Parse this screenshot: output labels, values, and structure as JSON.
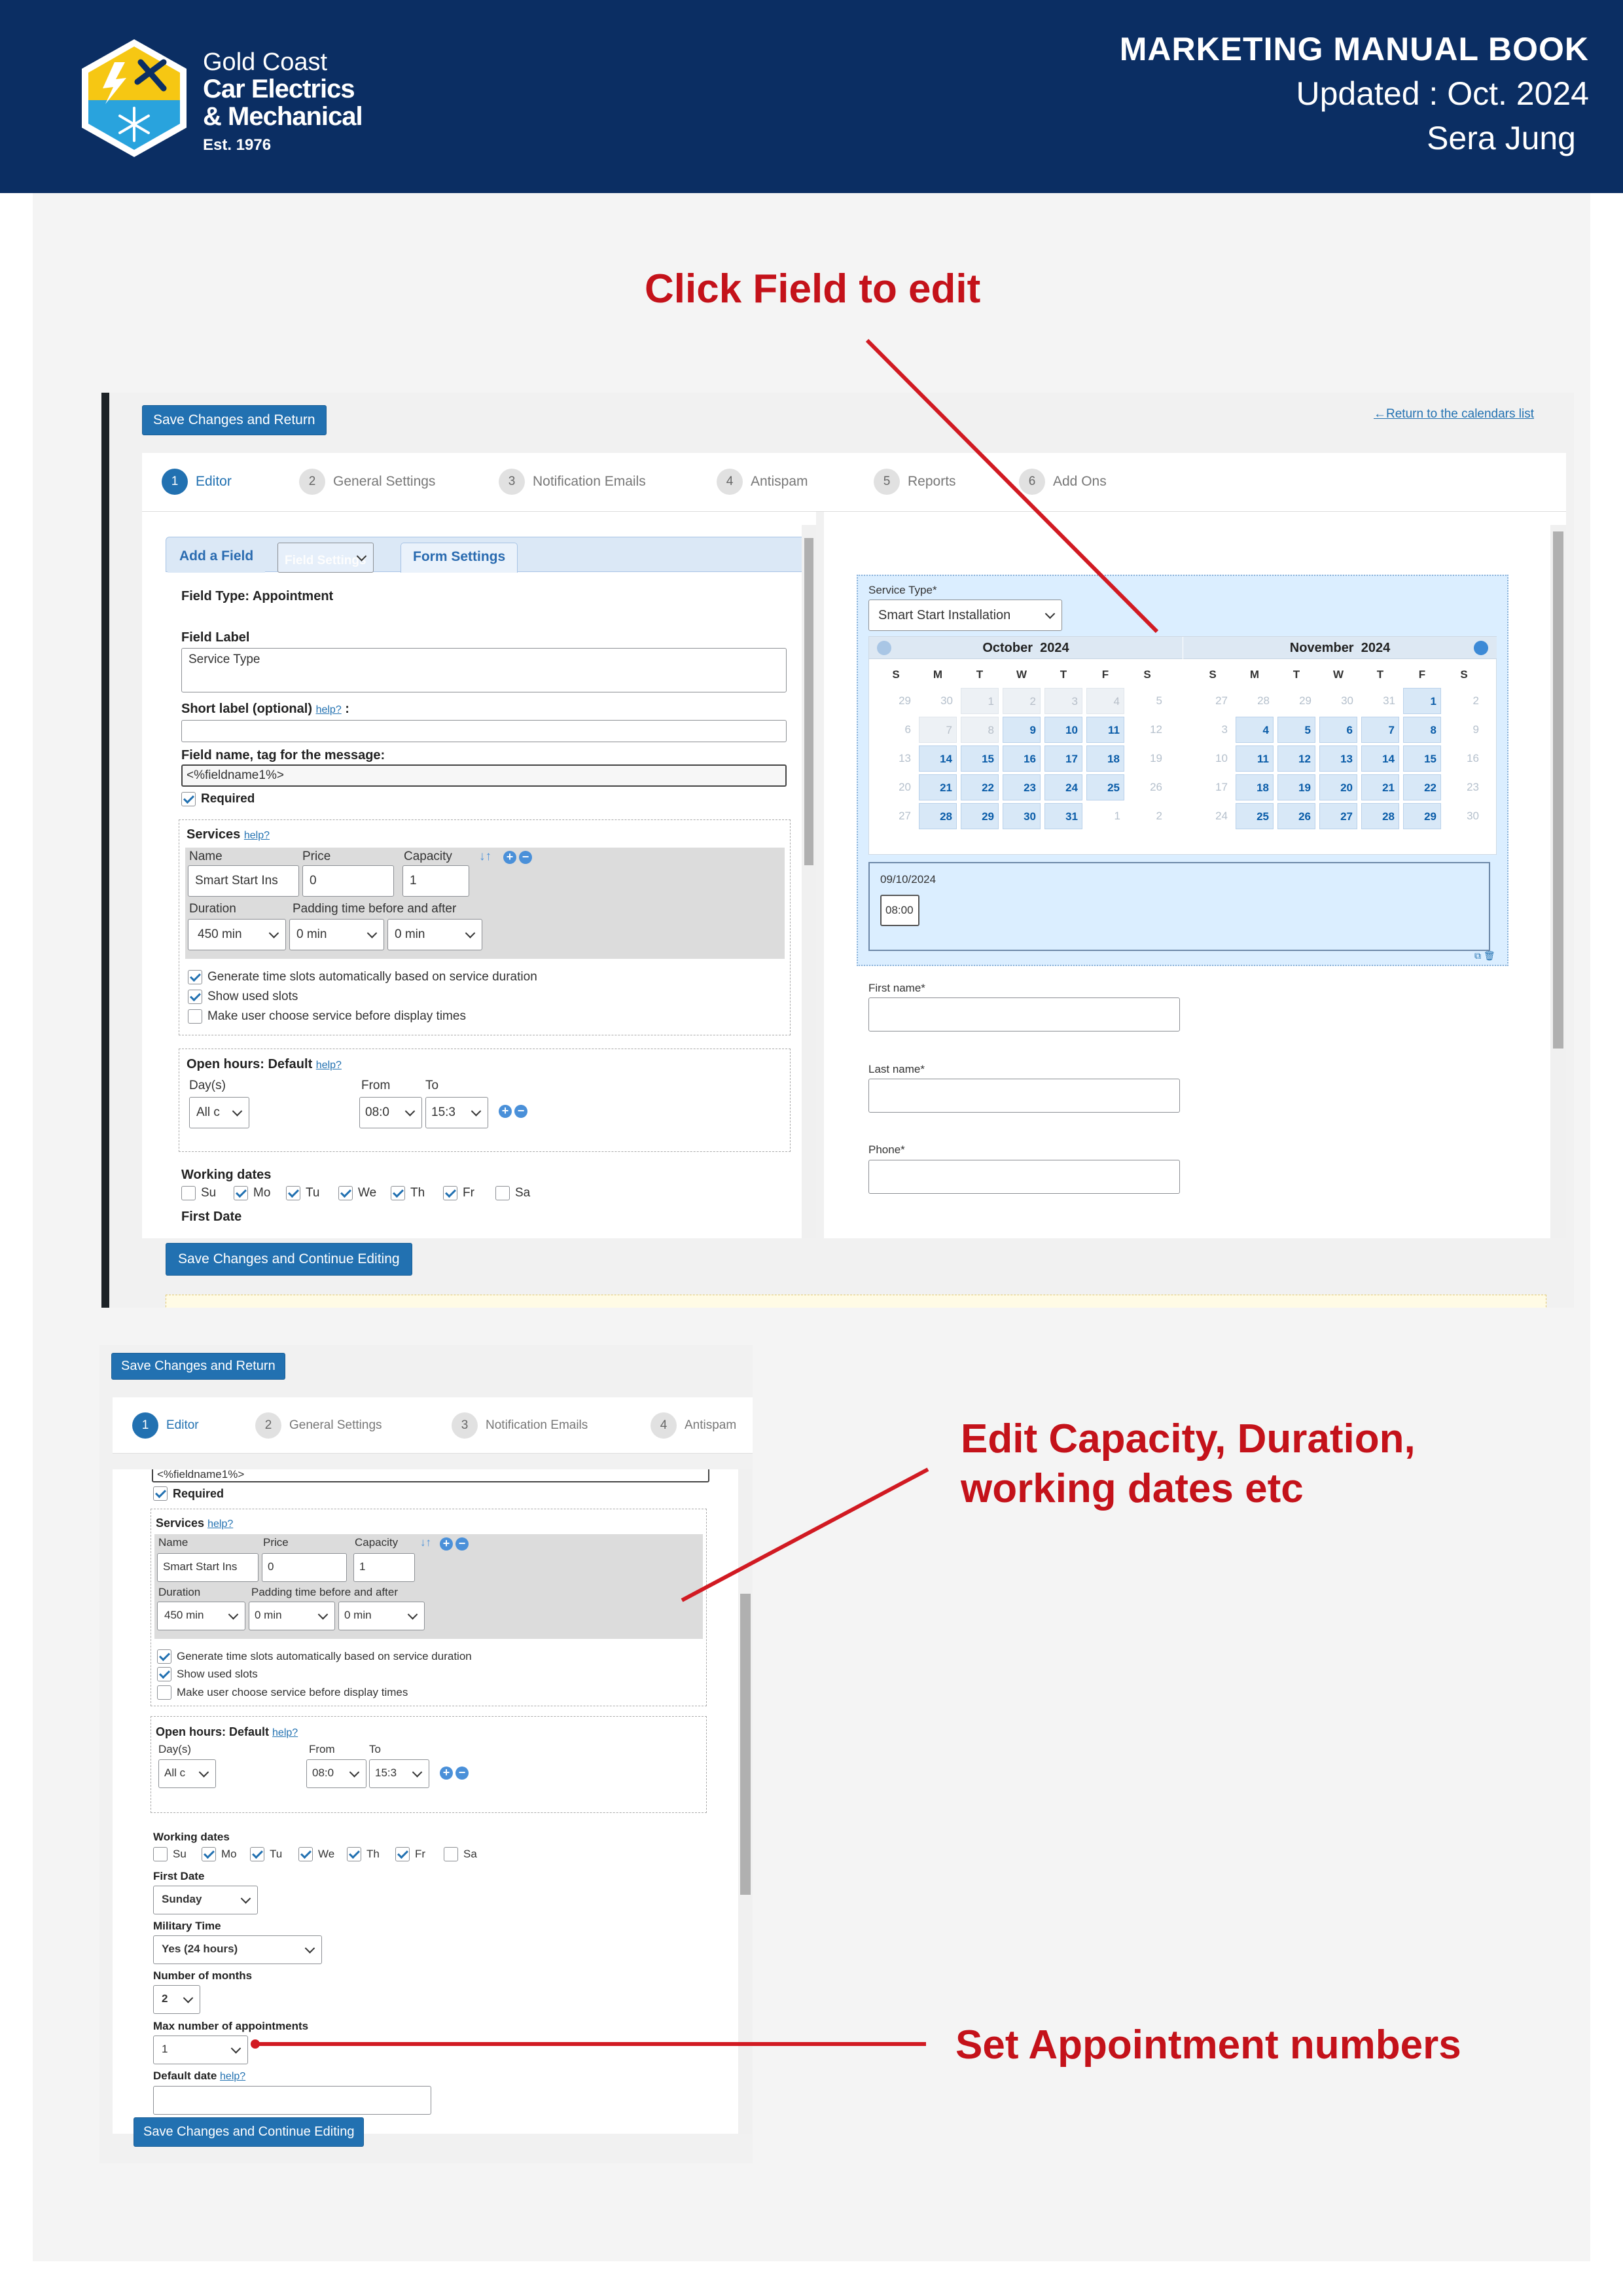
{
  "header": {
    "brand_line1": "Gold Coast",
    "brand_line2": "Car Electrics",
    "brand_line3": "& Mechanical",
    "brand_line4": "Est. 1976",
    "doc_title": "MARKETING MANUAL BOOK",
    "updated": "Updated : Oct. 2024",
    "author": "Sera Jung",
    "colors": {
      "header_bg": "#0b2e63",
      "annotation": "#c4121a",
      "accent": "#2271b1"
    }
  },
  "annotations": {
    "click_field": "Click Field to edit",
    "edit_capacity_line1": "Edit Capacity, Duration,",
    "edit_capacity_line2": "working dates etc",
    "set_appointments": "Set Appointment numbers"
  },
  "shot1": {
    "save_return": "Save Changes and Return",
    "return_link": "←Return to the calendars list",
    "steps": [
      {
        "num": "1",
        "label": "Editor"
      },
      {
        "num": "2",
        "label": "General Settings"
      },
      {
        "num": "3",
        "label": "Notification Emails"
      },
      {
        "num": "4",
        "label": "Antispam"
      },
      {
        "num": "5",
        "label": "Reports"
      },
      {
        "num": "6",
        "label": "Add Ons"
      }
    ],
    "tabs": {
      "add_field": "Add a Field",
      "field_settings": "Field Settings",
      "form_settings": "Form Settings"
    },
    "field_type": "Field Type: Appointment",
    "field_label_title": "Field Label",
    "field_label_value": "Service Type",
    "short_label_title": "Short label (optional)",
    "help": "help?",
    "colon": ":",
    "field_name_title": "Field name, tag for the message:",
    "field_name_value": "<%fieldname1%>",
    "required": "Required",
    "services_title": "Services",
    "col_name": "Name",
    "col_price": "Price",
    "col_capacity": "Capacity",
    "service_name": "Smart Start Ins",
    "service_price": "0",
    "service_capacity": "1",
    "col_duration": "Duration",
    "col_padding": "Padding time before and after",
    "duration_value": "450 min",
    "padding_before": "0 min",
    "padding_after": "0 min",
    "sort_arrows": "↓↑",
    "gen_slots": "Generate time slots automatically based on service duration",
    "show_used": "Show used slots",
    "make_choose": "Make user choose service before display times",
    "open_hours": "Open hours: Default",
    "days_label": "Day(s)",
    "from_label": "From",
    "to_label": "To",
    "days_value": "All c",
    "from_value": "08:0",
    "to_value": "15:3",
    "working_dates": "Working dates",
    "days": [
      "Su",
      "Mo",
      "Tu",
      "We",
      "Th",
      "Fr",
      "Sa"
    ],
    "days_checked": [
      false,
      true,
      true,
      true,
      true,
      true,
      false
    ],
    "first_date": "First Date",
    "save_continue": "Save Changes and Continue Editing",
    "preview": {
      "service_type_label": "Service Type*",
      "service_type_value": "Smart Start Installation",
      "month1": "October",
      "year1": "2024",
      "month2": "November",
      "year2": "2024",
      "weekdays": [
        "S",
        "M",
        "T",
        "W",
        "T",
        "F",
        "S"
      ],
      "selected_date": "09/10/2024",
      "slot": "08:00",
      "first_name": "First name*",
      "last_name": "Last name*",
      "phone": "Phone*"
    }
  },
  "shot2": {
    "save_return": "Save Changes and Return",
    "steps": [
      {
        "num": "1",
        "label": "Editor"
      },
      {
        "num": "2",
        "label": "General Settings"
      },
      {
        "num": "3",
        "label": "Notification Emails"
      },
      {
        "num": "4",
        "label": "Antispam"
      }
    ],
    "field_name_value": "<%fieldname1%>",
    "required": "Required",
    "services_title": "Services",
    "help": "help?",
    "col_name": "Name",
    "col_price": "Price",
    "col_capacity": "Capacity",
    "service_name": "Smart Start Ins",
    "service_price": "0",
    "service_capacity": "1",
    "col_duration": "Duration",
    "col_padding": "Padding time before and after",
    "duration_value": "450 min",
    "padding_before": "0 min",
    "padding_after": "0 min",
    "sort_arrows": "↓↑",
    "gen_slots": "Generate time slots automatically based on service duration",
    "show_used": "Show used slots",
    "make_choose": "Make user choose service before display times",
    "open_hours": "Open hours: Default",
    "days_label": "Day(s)",
    "from_label": "From",
    "to_label": "To",
    "days_value": "All c",
    "from_value": "08:0",
    "to_value": "15:3",
    "working_dates": "Working dates",
    "days": [
      "Su",
      "Mo",
      "Tu",
      "We",
      "Th",
      "Fr",
      "Sa"
    ],
    "days_checked": [
      false,
      true,
      true,
      true,
      true,
      true,
      false
    ],
    "first_date": "First Date",
    "first_date_value": "Sunday",
    "military_time": "Military Time",
    "military_value": "Yes (24 hours)",
    "num_months": "Number of months",
    "num_months_value": "2",
    "max_appts": "Max number of appointments",
    "max_appts_value": "1",
    "default_date": "Default date",
    "save_continue": "Save Changes and Continue Editing"
  }
}
